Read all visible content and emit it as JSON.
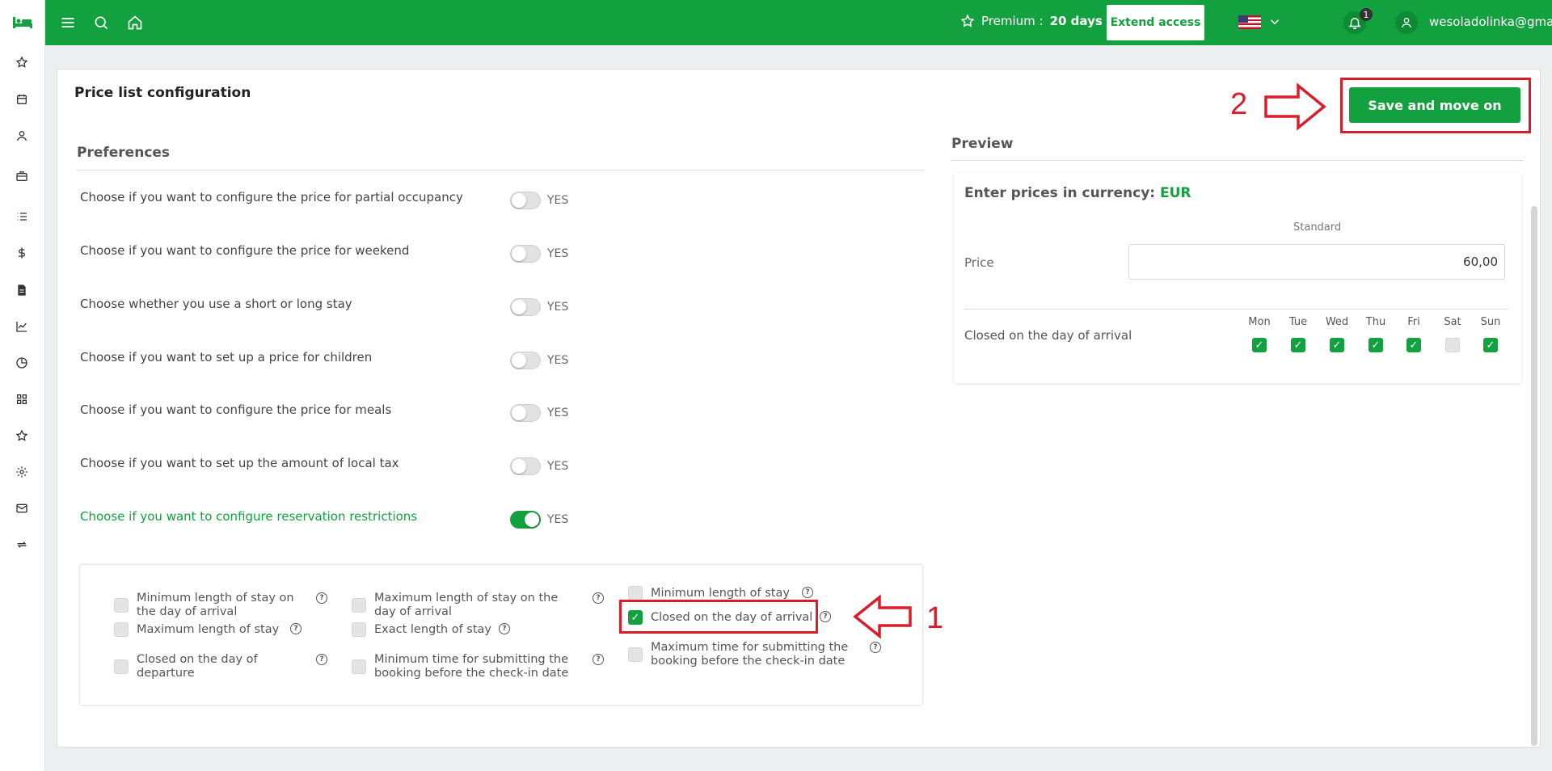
{
  "header": {
    "premium_label": "Premium :",
    "premium_days": "20 days",
    "extend_label": "Extend access",
    "notification_count": "1",
    "user_email": "wesoladolinka@gmail.com"
  },
  "page": {
    "title": "Price list configuration"
  },
  "actions": {
    "save_label": "Save and move on"
  },
  "preferences": {
    "title": "Preferences",
    "toggle_text": "YES",
    "items": [
      {
        "label": "Choose if you want to configure the price for partial occupancy",
        "enabled": false
      },
      {
        "label": "Choose if you want to configure the price for weekend",
        "enabled": false
      },
      {
        "label": "Choose whether you use a short or long stay",
        "enabled": false
      },
      {
        "label": "Choose if you want to set up a price for children",
        "enabled": false
      },
      {
        "label": "Choose if you want to configure the price for meals",
        "enabled": false
      },
      {
        "label": "Choose if you want to set up the amount of local tax",
        "enabled": false
      },
      {
        "label": "Choose if you want to configure reservation restrictions",
        "enabled": true
      }
    ]
  },
  "restrictions": [
    {
      "label": "Minimum length of stay on the day of arrival",
      "checked": false
    },
    {
      "label": "Maximum length of stay on the day of arrival",
      "checked": false
    },
    {
      "label": "Minimum length of stay",
      "checked": false
    },
    {
      "label": "Maximum length of stay",
      "checked": false
    },
    {
      "label": "Exact length of stay",
      "checked": false
    },
    {
      "label": "Closed on the day of arrival",
      "checked": true
    },
    {
      "label": "Closed on the day of departure",
      "checked": false
    },
    {
      "label": "Minimum time for submitting the booking before the check-in date",
      "checked": false
    },
    {
      "label": "Maximum time for submitting the booking before the check-in date",
      "checked": false
    }
  ],
  "preview": {
    "title": "Preview",
    "currency_prefix": "Enter prices in currency:",
    "currency": "EUR",
    "column_header": "Standard",
    "price_label": "Price",
    "price_value": "60,00",
    "closed_label": "Closed on the day of arrival",
    "days": [
      {
        "name": "Mon",
        "checked": true
      },
      {
        "name": "Tue",
        "checked": true
      },
      {
        "name": "Wed",
        "checked": true
      },
      {
        "name": "Thu",
        "checked": true
      },
      {
        "name": "Fri",
        "checked": true
      },
      {
        "name": "Sat",
        "checked": false
      },
      {
        "name": "Sun",
        "checked": true
      }
    ]
  },
  "annotations": {
    "step1": "1",
    "step2": "2",
    "color": "#d81e2a"
  },
  "theme": {
    "primary": "#13a03f"
  }
}
